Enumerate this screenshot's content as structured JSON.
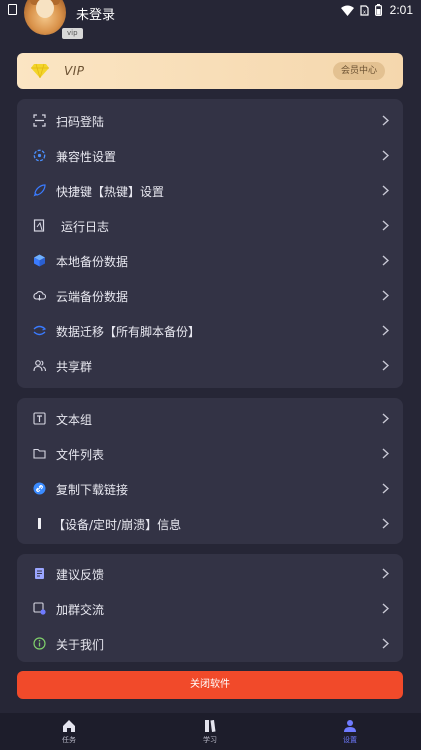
{
  "profile": {
    "username": "未登录",
    "vip_tag": "vip"
  },
  "status_bar": {
    "time": "2:01"
  },
  "vip_banner": {
    "label": "VIP",
    "member_center": "会员中心"
  },
  "groups": [
    {
      "items": [
        {
          "label": "扫码登陆",
          "icon": "scan-icon"
        },
        {
          "label": "兼容性设置",
          "icon": "compatibility-icon"
        },
        {
          "label": "快捷键【热键】设置",
          "icon": "rocket-icon"
        },
        {
          "label": "运行日志",
          "icon": "log-icon"
        },
        {
          "label": "本地备份数据",
          "icon": "cube-icon"
        },
        {
          "label": "云端备份数据",
          "icon": "cloud-icon"
        },
        {
          "label": "数据迁移【所有脚本备份】",
          "icon": "migrate-icon"
        },
        {
          "label": "共享群",
          "icon": "group-icon"
        }
      ]
    },
    {
      "items": [
        {
          "label": "文本组",
          "icon": "text-icon"
        },
        {
          "label": "文件列表",
          "icon": "folder-icon"
        },
        {
          "label": "复制下载链接",
          "icon": "link-icon"
        },
        {
          "label": "【设备/定时/崩溃】信息",
          "icon": "info-bar-icon"
        }
      ]
    },
    {
      "items": [
        {
          "label": "建议反馈",
          "icon": "feedback-icon"
        },
        {
          "label": "加群交流",
          "icon": "chat-group-icon"
        },
        {
          "label": "关于我们",
          "icon": "about-icon"
        }
      ]
    }
  ],
  "close_button": "关闭软件",
  "tabs": [
    {
      "label": "任务",
      "icon": "home-icon",
      "active": false
    },
    {
      "label": "学习",
      "icon": "book-icon",
      "active": false
    },
    {
      "label": "设置",
      "icon": "user-icon",
      "active": true
    }
  ],
  "colors": {
    "accent": "#6f7bff",
    "close": "#f14a2a",
    "panel": "#333345",
    "background": "#262636"
  }
}
